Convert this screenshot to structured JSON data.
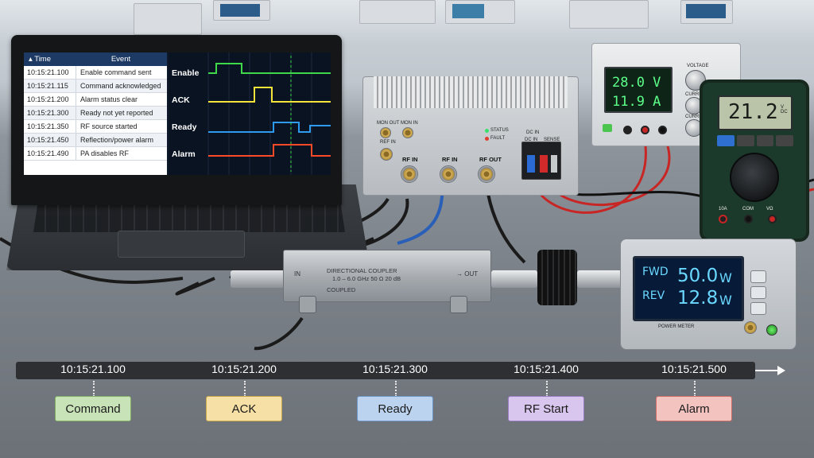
{
  "laptop": {
    "table_headers": {
      "time": "Time",
      "event": "Event"
    },
    "events": [
      {
        "time": "10:15:21.100",
        "event": "Enable command sent"
      },
      {
        "time": "10:15:21.115",
        "event": "Command acknowledged"
      },
      {
        "time": "10:15:21.200",
        "event": "Alarm status clear"
      },
      {
        "time": "10:15:21.300",
        "event": "Ready not yet reported"
      },
      {
        "time": "10:15:21.350",
        "event": "RF source started"
      },
      {
        "time": "10:15:21.450",
        "event": "Reflection/power alarm"
      },
      {
        "time": "10:15:21.490",
        "event": "PA disables RF"
      }
    ],
    "waveforms": [
      {
        "label": "Enable",
        "color": "#3ed84a"
      },
      {
        "label": "ACK",
        "color": "#f4e43a"
      },
      {
        "label": "Ready",
        "color": "#2f9bf0"
      },
      {
        "label": "Alarm",
        "color": "#ff4a2a"
      }
    ]
  },
  "amplifier": {
    "ports": [
      "MON OUT",
      "MON IN",
      "REF IN",
      "RF IN",
      "RF IN",
      "RF OUT"
    ],
    "status": [
      {
        "label": "STATUS",
        "color": "#39e06a"
      },
      {
        "label": "FAULT",
        "color": "#e03b2b"
      }
    ],
    "dc_labels": [
      "DC IN",
      "DC IN",
      "SENSE"
    ]
  },
  "power_supply": {
    "voltage": "28.0 V",
    "current": "11.9 A",
    "labels": [
      "VOLTAGE",
      "CURRENT",
      "CURRENT"
    ]
  },
  "multimeter": {
    "reading": "21.2",
    "unit": "V DC",
    "labels": [
      "10A",
      "COM",
      "VΩ"
    ]
  },
  "coupler": {
    "title": "DIRECTIONAL COUPLER",
    "spec": "1.0 – 6.0 GHz      50 Ω      20 dB",
    "port_in": "IN",
    "port_out": "OUT",
    "port_coupled": "COUPLED"
  },
  "power_meter": {
    "fwd_label": "FWD",
    "fwd_value": "50.0",
    "fwd_unit": "W",
    "rev_label": "REV",
    "rev_value": "12.8",
    "rev_unit": "W",
    "brand": "POWER METER"
  },
  "timeline": {
    "ticks": [
      "10:15:21.100",
      "10:15:21.200",
      "10:15:21.300",
      "10:15:21.400",
      "10:15:21.500"
    ],
    "phases": [
      {
        "label": "Command",
        "color": "#c9e3b9",
        "border": "#7fae64"
      },
      {
        "label": "ACK",
        "color": "#f6e0a6",
        "border": "#c8a84c"
      },
      {
        "label": "Ready",
        "color": "#bcd3ef",
        "border": "#6d95c8"
      },
      {
        "label": "RF Start",
        "color": "#d9c6ef",
        "border": "#9a7cc4"
      },
      {
        "label": "Alarm",
        "color": "#f3c3c0",
        "border": "#cc6e67"
      }
    ]
  }
}
